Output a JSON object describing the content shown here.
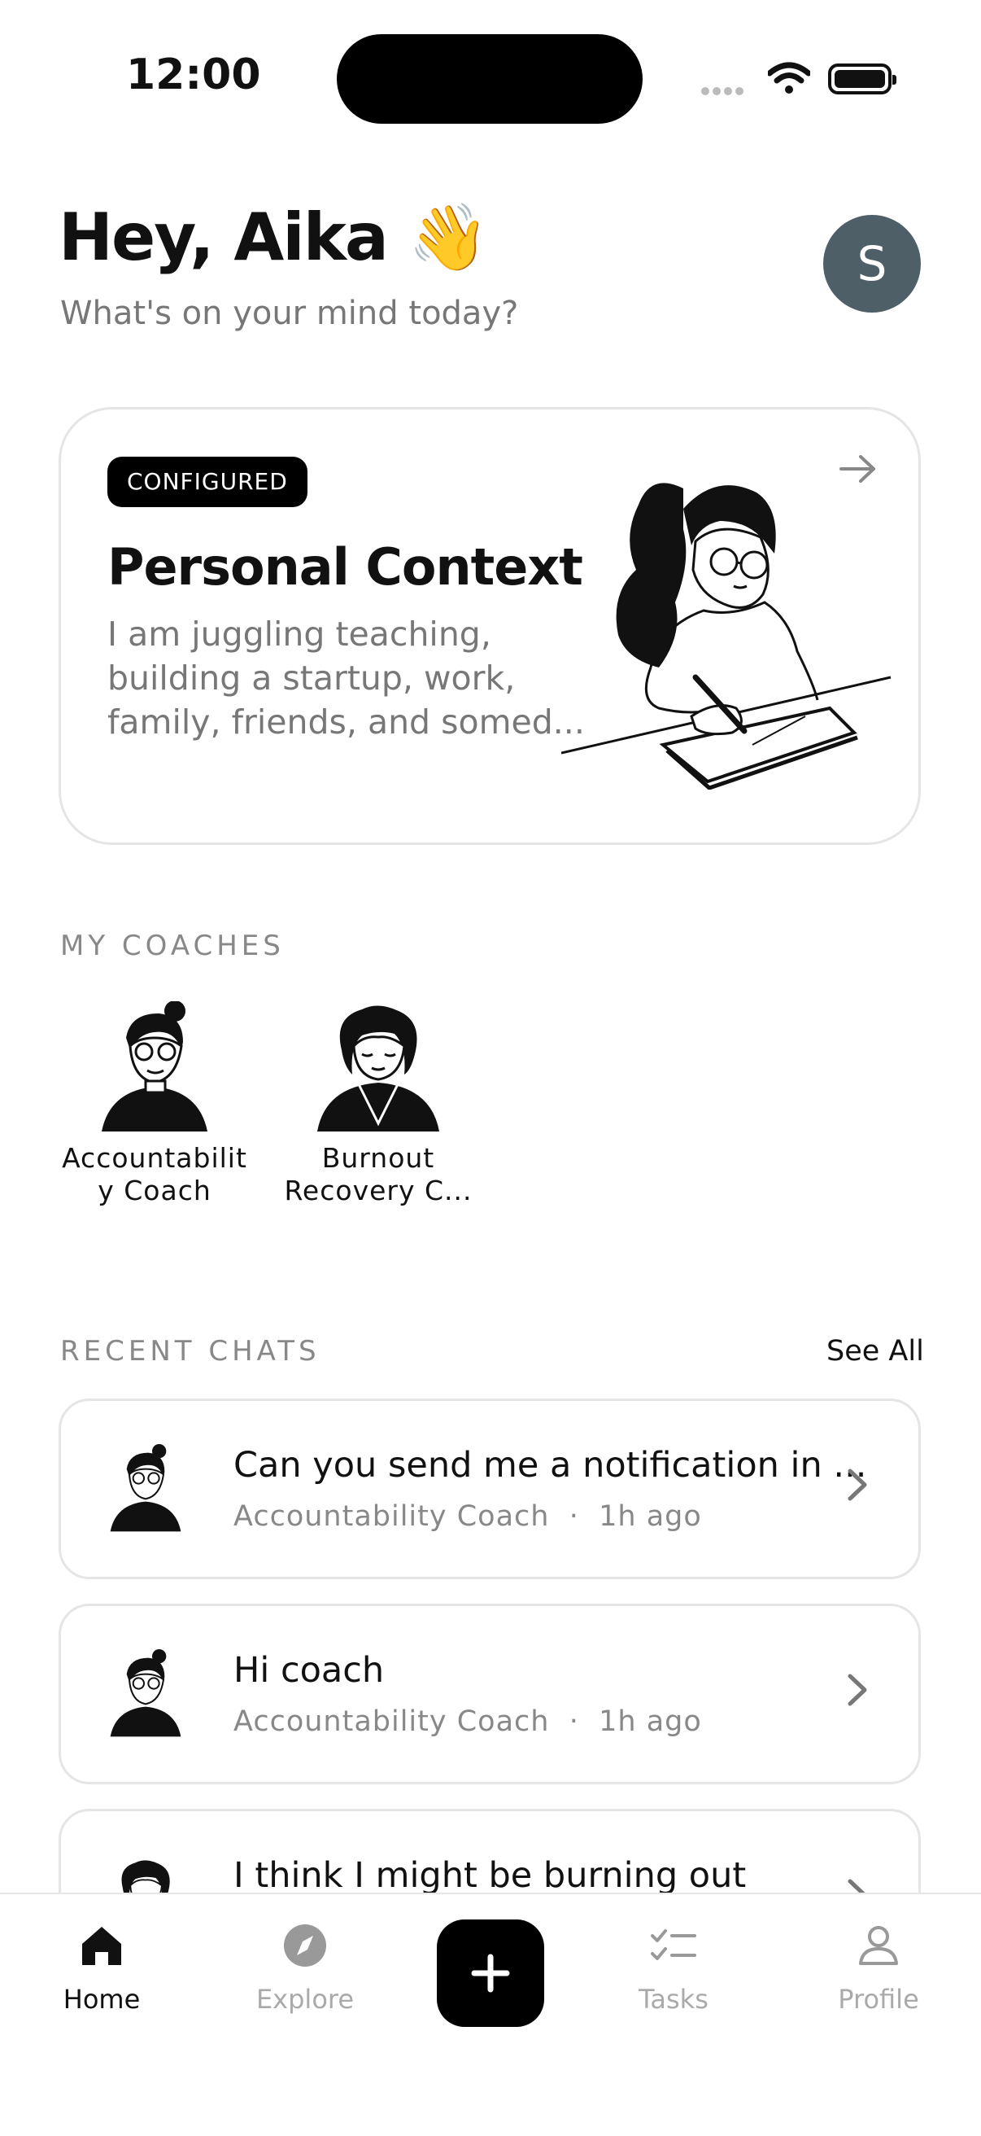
{
  "status_bar": {
    "time": "12:00"
  },
  "header": {
    "greeting": "Hey, Aika 👋",
    "subtitle": "What's on your mind today?",
    "avatar_initial": "S"
  },
  "context_card": {
    "badge": "CONFIGURED",
    "title": "Personal Context",
    "body": "I am juggling teaching, building a startup, work, family, friends, and somed..."
  },
  "coaches": {
    "label": "MY COACHES",
    "items": [
      {
        "name": "Accountabilit y Coach"
      },
      {
        "name": "Burnout Recovery C..."
      }
    ]
  },
  "recent_chats": {
    "label": "RECENT CHATS",
    "see_all": "See All",
    "items": [
      {
        "title": "Can you send me a notification in ...",
        "coach": "Accountability Coach",
        "time": "1h ago"
      },
      {
        "title": "Hi coach",
        "coach": "Accountability Coach",
        "time": "1h ago"
      },
      {
        "title": "I think I might be burning out",
        "coach": "",
        "time": ""
      }
    ],
    "separator": "·"
  },
  "tabbar": {
    "tabs": [
      {
        "label": "Home",
        "icon": "home-icon",
        "active": true
      },
      {
        "label": "Explore",
        "icon": "compass-icon",
        "active": false
      },
      {
        "label": "Tasks",
        "icon": "tasks-icon",
        "active": false
      },
      {
        "label": "Profile",
        "icon": "person-icon",
        "active": false
      }
    ],
    "new_chat_icon": "plus-icon"
  }
}
